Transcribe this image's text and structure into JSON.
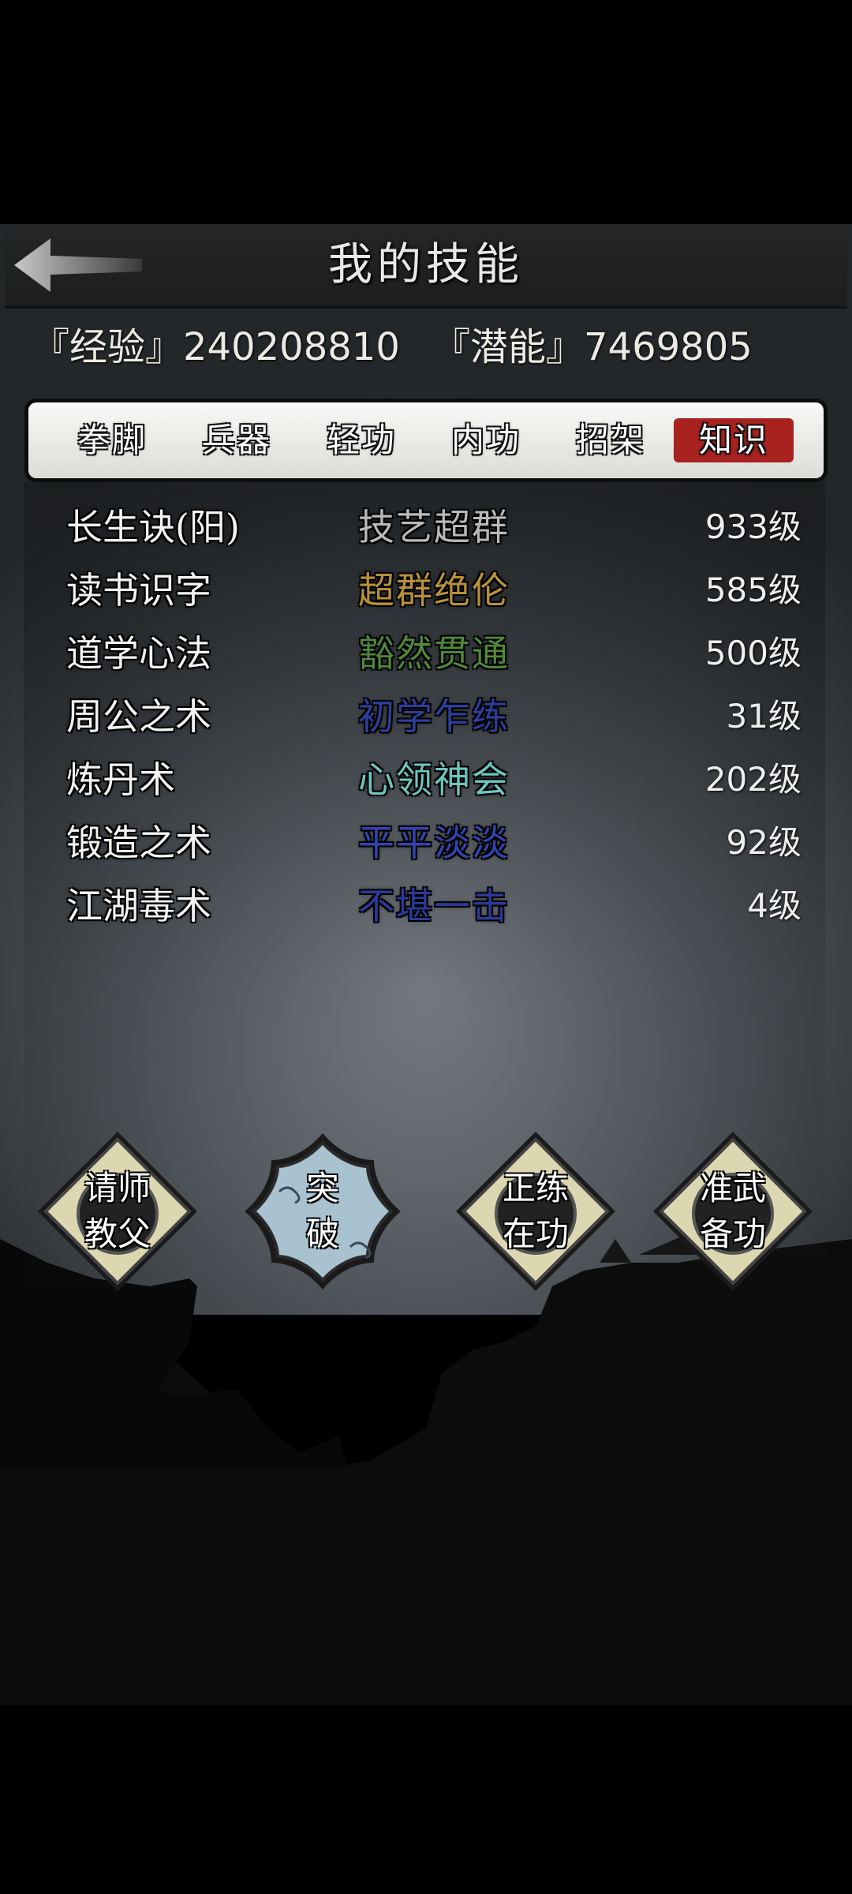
{
  "header": {
    "title": "我的技能",
    "back_icon": "back-arrow-icon"
  },
  "stats": {
    "experience": "『经验』240208810",
    "potential": "『潜能』7469805"
  },
  "tabs": [
    {
      "label": "拳脚",
      "active": false
    },
    {
      "label": "兵器",
      "active": false
    },
    {
      "label": "轻功",
      "active": false
    },
    {
      "label": "内功",
      "active": false
    },
    {
      "label": "招架",
      "active": false
    },
    {
      "label": "知识",
      "active": true
    }
  ],
  "skills": [
    {
      "name": "长生诀(阳)",
      "rank": "技艺超群",
      "rank_color": "#b9b9b9",
      "level": "933级"
    },
    {
      "name": "读书识字",
      "rank": "超群绝伦",
      "rank_color": "#b8913c",
      "level": "585级"
    },
    {
      "name": "道学心法",
      "rank": "豁然贯通",
      "rank_color": "#4f8a3a",
      "level": "500级"
    },
    {
      "name": "周公之术",
      "rank": "初学乍练",
      "rank_color": "#2c3f9c",
      "level": "31级"
    },
    {
      "name": "炼丹术",
      "rank": "心领神会",
      "rank_color": "#6ec6c0",
      "level": "202级"
    },
    {
      "name": "锻造之术",
      "rank": "平平淡淡",
      "rank_color": "#3144b0",
      "level": "92级"
    },
    {
      "name": "江湖毒术",
      "rank": "不堪一击",
      "rank_color": "#2a3a9a",
      "level": "4级"
    }
  ],
  "actions": [
    {
      "line1": "请师",
      "line2": "教父",
      "style": "diamond"
    },
    {
      "line1": "突",
      "line2": "破",
      "style": "cloud"
    },
    {
      "line1": "正练",
      "line2": "在功",
      "style": "diamond"
    },
    {
      "line1": "准武",
      "line2": "备功",
      "style": "diamond"
    }
  ],
  "colors": {
    "active_tab": "#a8221f",
    "button_face": "#dcd7b0",
    "cloud_button": "#a9c2d0"
  }
}
